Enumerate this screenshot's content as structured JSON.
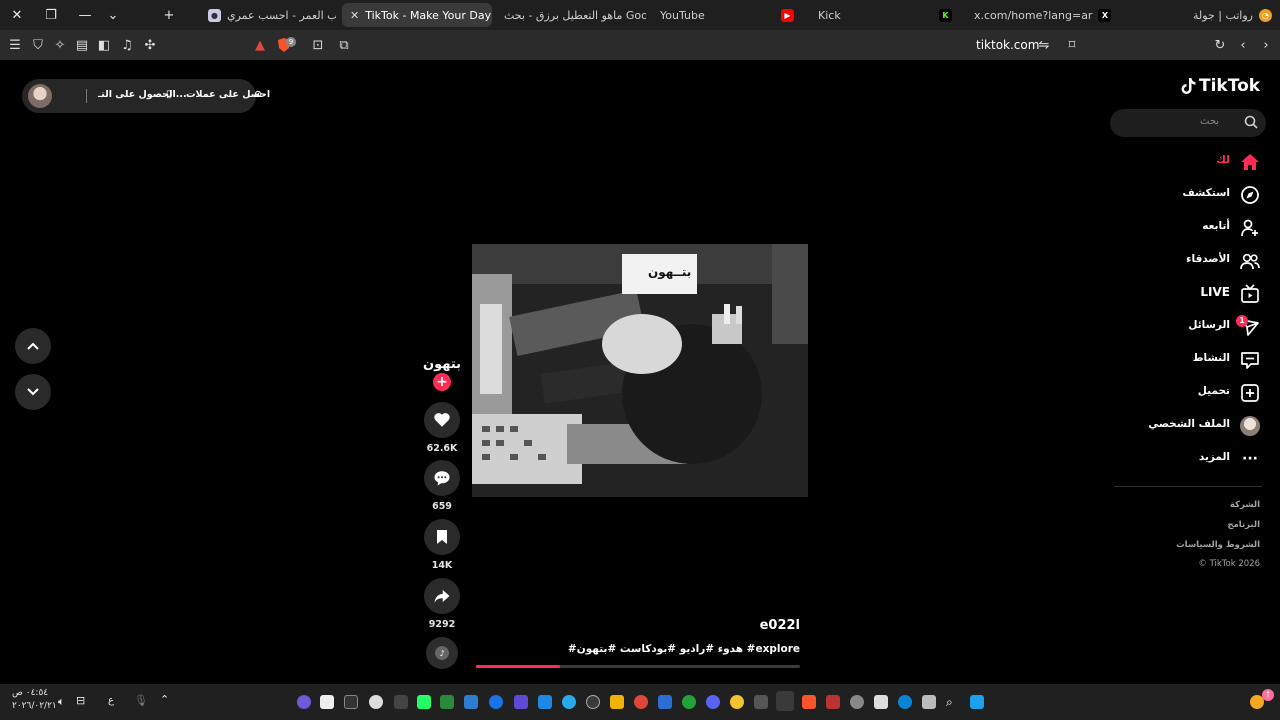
{
  "browser": {
    "tabs": [
      {
        "label": "رواتب | جولة",
        "favicon": "clock-icon",
        "active": false
      },
      {
        "label": "x.com/home?lang=ar",
        "favicon": "x-logo-icon",
        "active": false
      },
      {
        "label": "Kick",
        "favicon": "kick-logo-icon",
        "active": false
      },
      {
        "label": "YouTube",
        "favicon": "youtube-logo-icon",
        "active": false
      },
      {
        "label": "ماهو التعطيل برزق - بحث Google",
        "favicon": "google-logo-icon",
        "active": false
      },
      {
        "label": "TikTok - Make Your Day",
        "favicon": "tiktok-logo-icon",
        "active": true
      },
      {
        "label": "حساب العمر - احسب عمري",
        "favicon": "globe-icon",
        "active": false
      }
    ],
    "url": "tiktok.com",
    "shield_count": "9"
  },
  "tiktok": {
    "logo": "TikTok",
    "search_placeholder": "بحث",
    "nav": [
      {
        "label": "لك",
        "icon": "home-icon",
        "active": true
      },
      {
        "label": "استكشف",
        "icon": "compass-icon",
        "active": false
      },
      {
        "label": "أتابعه",
        "icon": "user-plus-icon",
        "active": false
      },
      {
        "label": "الأصدقاء",
        "icon": "friends-icon",
        "active": false
      },
      {
        "label": "LIVE",
        "icon": "live-tv-icon",
        "active": false
      },
      {
        "label": "الرسائل",
        "icon": "send-icon",
        "active": false,
        "badge": "1"
      },
      {
        "label": "النشاط",
        "icon": "activity-icon",
        "active": false
      },
      {
        "label": "تحميل",
        "icon": "upload-plus-icon",
        "active": false
      },
      {
        "label": "الملف الشخصي",
        "icon": "profile-avatar-icon",
        "active": false
      },
      {
        "label": "المزيد",
        "icon": "more-dots-icon",
        "active": false
      }
    ],
    "footer": [
      "الشركة",
      "البرنامج",
      "الشروط والسياسات",
      "© TikTok 2026"
    ],
    "top_pill": {
      "get_coins": "احصل على عملات",
      "get_app": "الحصول على التـ..."
    },
    "video": {
      "username": "e022l",
      "caption": "#هدوء #راديو #بودكاست #بتهون #explore",
      "overlay_text": "بتــهون",
      "progress": 0.26,
      "creator_label": "بتهون",
      "likes": "62.6K",
      "comments": "659",
      "saves": "14K",
      "shares": "9292"
    }
  },
  "taskbar": {
    "time": "٠٤:٥٤ ص",
    "date": "٢٠٢٦/٠٢/٢١",
    "lang": "ع"
  },
  "accent_color": "#fe2c55"
}
